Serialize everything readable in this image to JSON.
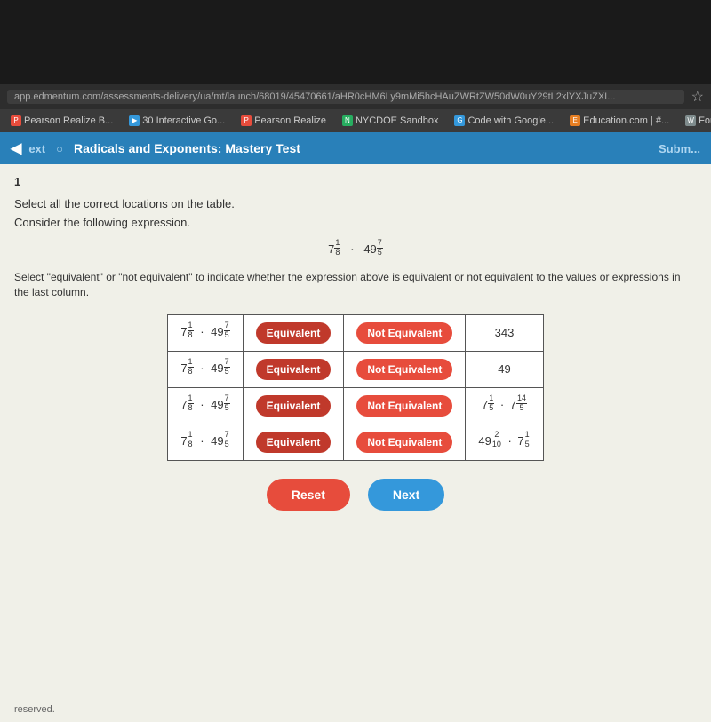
{
  "browser": {
    "url": "app.edmentum.com/assessments-delivery/ua/mt/launch/68019/45470661/aHR0cHM6Ly9mMi5hcHAuZWRtZW50dW0uY29tL2xlYXJuZXI...",
    "bookmarks": [
      {
        "label": "Pearson Realize B...",
        "icon": "P",
        "color": "red"
      },
      {
        "label": "30 Interactive Go...",
        "icon": "▶",
        "color": "blue"
      },
      {
        "label": "Pearson Realize",
        "icon": "P",
        "color": "red"
      },
      {
        "label": "NYCDOE Sandbox",
        "icon": "N",
        "color": "green"
      },
      {
        "label": "Code with Google...",
        "icon": "G",
        "color": "blue"
      },
      {
        "label": "Education.com | #...",
        "icon": "E",
        "color": "orange"
      },
      {
        "label": "Fourth Grade",
        "icon": "W",
        "color": "gray"
      }
    ]
  },
  "header": {
    "title": "Radicals and Exponents: Mastery Test",
    "back_label": "ext",
    "submit_label": "Subm..."
  },
  "question": {
    "number": "1",
    "instruction1": "Select all the correct locations on the table.",
    "instruction2": "Consider the following expression.",
    "instruction3": "Select \"equivalent\" or \"not equivalent\" to indicate whether the expression above is equivalent or not equivalent to the values or expressions in the last column.",
    "expression_main": "7⅛ · 49⁷⁄⁵",
    "table": {
      "rows": [
        {
          "expr": "7^(1/8) · 49^(7/5)",
          "base1": "7",
          "exp1_num": "1",
          "exp1_den": "8",
          "base2": "49",
          "exp2_num": "7",
          "exp2_den": "5",
          "equivalent_label": "Equivalent",
          "not_equivalent_label": "Not Equivalent",
          "value_label": "343",
          "value_type": "number"
        },
        {
          "expr": "7^(1/8) · 49^(7/5)",
          "base1": "7",
          "exp1_num": "1",
          "exp1_den": "8",
          "base2": "49",
          "exp2_num": "7",
          "exp2_den": "5",
          "equivalent_label": "Equivalent",
          "not_equivalent_label": "Not Equivalent",
          "value_label": "49",
          "value_type": "number"
        },
        {
          "expr": "7^(1/8) · 49^(7/5)",
          "base1": "7",
          "exp1_num": "1",
          "exp1_den": "8",
          "base2": "49",
          "exp2_num": "7",
          "exp2_den": "5",
          "equivalent_label": "Equivalent",
          "not_equivalent_label": "Not Equivalent",
          "value_label": "7^(1/5) · 7^(14/5)",
          "value_type": "expression",
          "val_base1": "7",
          "val_exp1_num": "1",
          "val_exp1_den": "5",
          "val_base2": "7",
          "val_exp2_num": "14",
          "val_exp2_den": "5"
        },
        {
          "expr": "7^(1/8) · 49^(7/5)",
          "base1": "7",
          "exp1_num": "1",
          "exp1_den": "8",
          "base2": "49",
          "exp2_num": "7",
          "exp2_den": "5",
          "equivalent_label": "Equivalent",
          "not_equivalent_label": "Not Equivalent",
          "value_label": "49^(2/10) · 7^(1/5)",
          "value_type": "expression",
          "val_base1": "49",
          "val_exp1_num": "2",
          "val_exp1_den": "10",
          "val_base2": "7",
          "val_exp2_num": "1",
          "val_exp2_den": "5"
        }
      ]
    }
  },
  "buttons": {
    "reset_label": "Reset",
    "next_label": "Next"
  },
  "footer": {
    "text": "reserved."
  }
}
